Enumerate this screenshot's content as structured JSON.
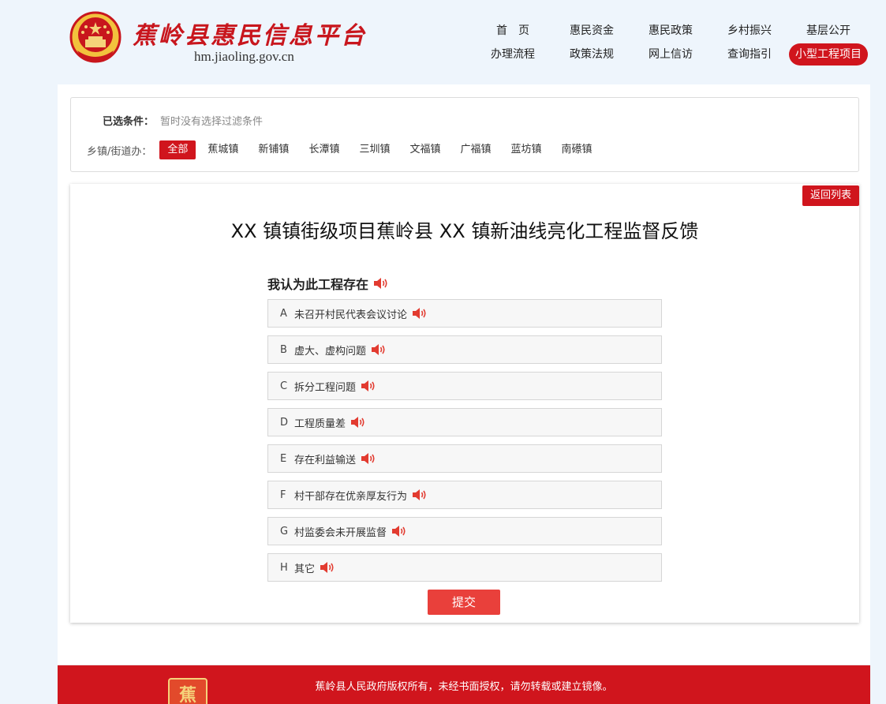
{
  "header": {
    "site_title": "蕉岭县惠民信息平台",
    "site_domain": "hm.jiaoling.gov.cn",
    "nav_row1": [
      "首　页",
      "惠民资金",
      "惠民政策",
      "乡村振兴",
      "基层公开"
    ],
    "nav_row2": [
      "办理流程",
      "政策法规",
      "网上信访",
      "查询指引",
      "小型工程项目"
    ],
    "active_nav": "小型工程项目"
  },
  "filter": {
    "selected_label": "已选条件：",
    "selected_value": "暂时没有选择过滤条件",
    "town_label": "乡镇/街道办：",
    "towns": [
      "全部",
      "蕉城镇",
      "新铺镇",
      "长潭镇",
      "三圳镇",
      "文福镇",
      "广福镇",
      "蓝坊镇",
      "南礤镇"
    ],
    "active_town": "全部"
  },
  "detail": {
    "back_label": "返回列表",
    "title": "XX 镇镇街级项目蕉岭县 XX 镇新油线亮化工程监督反馈",
    "question": "我认为此工程存在",
    "options": [
      {
        "letter": "A",
        "text": "未召开村民代表会议讨论"
      },
      {
        "letter": "B",
        "text": "虚大、虚构问题"
      },
      {
        "letter": "C",
        "text": "拆分工程问题"
      },
      {
        "letter": "D",
        "text": "工程质量差"
      },
      {
        "letter": "E",
        "text": "存在利益输送"
      },
      {
        "letter": "F",
        "text": "村干部存在优亲厚友行为"
      },
      {
        "letter": "G",
        "text": "村监委会未开展监督"
      },
      {
        "letter": "H",
        "text": "其它"
      }
    ],
    "submit_label": "提交"
  },
  "footer": {
    "copyright": "蕉岭县人民政府版权所有，未经书面授权，请勿转载或建立镜像。"
  },
  "icons": {
    "speaker": "speaker-icon",
    "emblem": "national-emblem-icon"
  },
  "colors": {
    "brand_red": "#d0151d",
    "submit_red": "#e9403b",
    "page_bg": "#eef5fc"
  }
}
